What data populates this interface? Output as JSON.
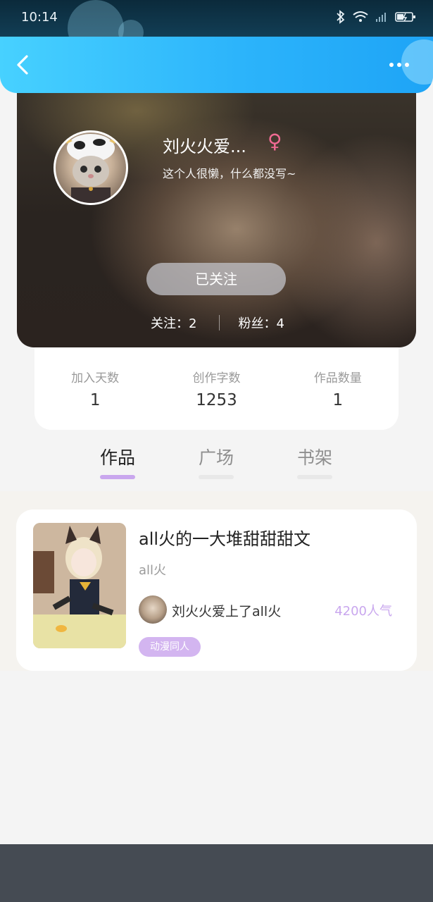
{
  "status_bar": {
    "time": "10:14",
    "icons": [
      "bluetooth-icon",
      "wifi-icon",
      "signal-icon",
      "battery-icon"
    ]
  },
  "header": {
    "back_icon": "chevron-left-icon",
    "more_icon": "more-dots-icon"
  },
  "profile": {
    "name": "刘火火爱...",
    "gender_symbol": "♀",
    "bio": "这个人很懒，什么都没写~",
    "follow_button_label": "已关注",
    "following_label": "关注：2",
    "followers_label": "粉丝：4"
  },
  "stats": [
    {
      "label": "加入天数",
      "value": "1"
    },
    {
      "label": "创作字数",
      "value": "1253"
    },
    {
      "label": "作品数量",
      "value": "1"
    }
  ],
  "tabs": [
    {
      "label": "作品",
      "active": true
    },
    {
      "label": "广场",
      "active": false
    },
    {
      "label": "书架",
      "active": false
    }
  ],
  "works": [
    {
      "title": "all火的一大堆甜甜甜文",
      "subtitle": "all火",
      "author": "刘火火爱上了all火",
      "popularity": "4200人气",
      "tag": "动漫同人"
    }
  ],
  "colors": {
    "header_blue": "#2cb4fb",
    "accent_purple": "#c9a7ee",
    "gender_pink": "#f06a93",
    "tag_purple": "#d3b5f0"
  }
}
